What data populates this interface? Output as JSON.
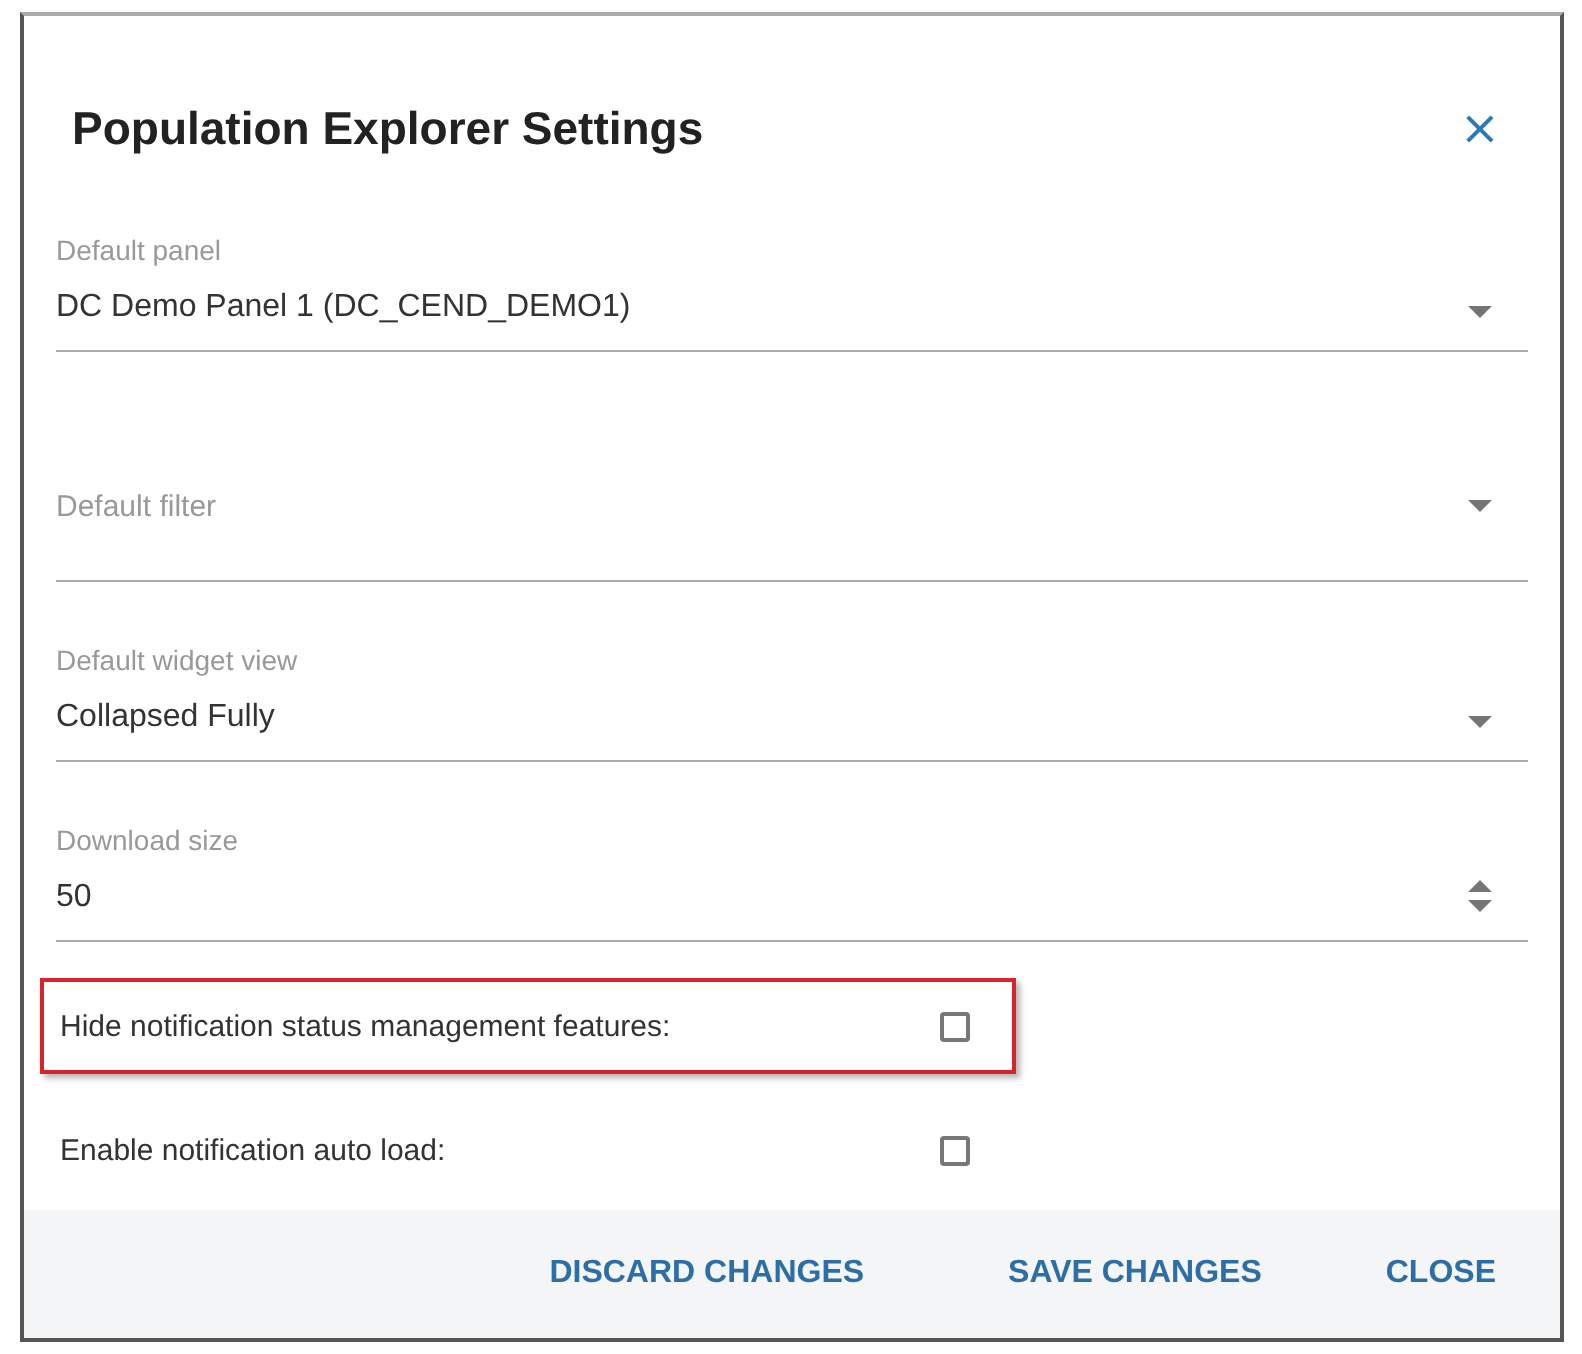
{
  "dialog": {
    "title": "Population Explorer Settings",
    "close_icon": "×"
  },
  "fields": [
    {
      "kind": "select",
      "label": "Default panel",
      "value": "DC Demo Panel 1 (DC_CEND_DEMO1)"
    },
    {
      "kind": "select",
      "label": "Default filter"
    },
    {
      "kind": "select",
      "label": "Default widget view",
      "value": "Collapsed Fully"
    },
    {
      "kind": "number",
      "label": "Download size",
      "value": "50"
    }
  ],
  "checkboxes": [
    {
      "label": "Hide notification status management features:",
      "checked": false,
      "highlighted": true
    },
    {
      "label": "Enable notification auto load:",
      "checked": false,
      "highlighted": false
    }
  ],
  "buttons": [
    "DISCARD CHANGES",
    "SAVE CHANGES",
    "CLOSE"
  ]
}
